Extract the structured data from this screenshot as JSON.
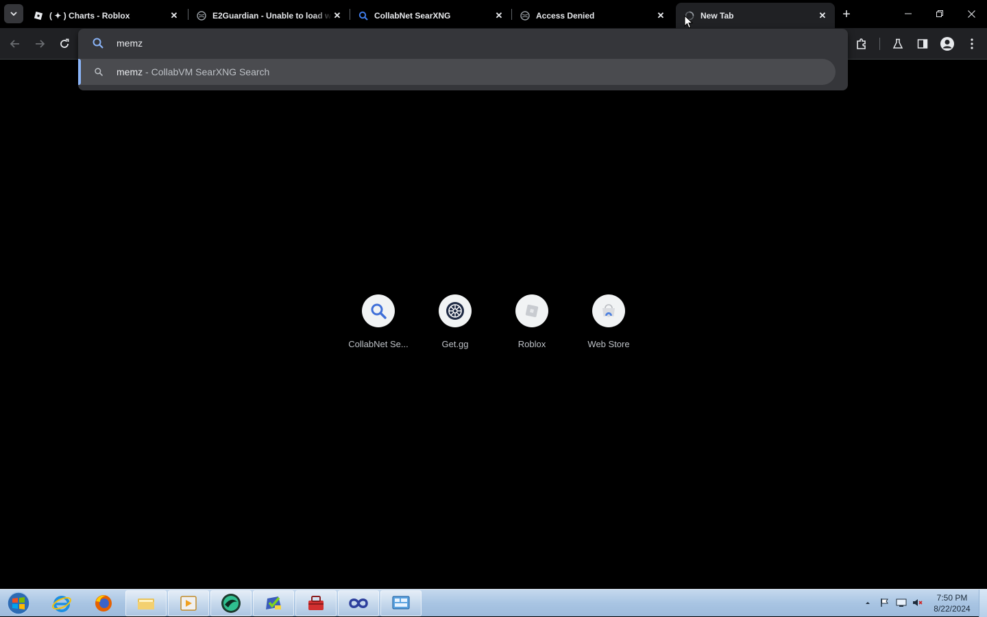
{
  "browser": {
    "tabs": [
      {
        "title": "( ✦ ) Charts - Roblox",
        "icon": "roblox-icon",
        "active": false
      },
      {
        "title": "E2Guardian - Unable to load w",
        "icon": "globe-icon",
        "active": false
      },
      {
        "title": "CollabNet SearXNG",
        "icon": "search-icon",
        "active": false
      },
      {
        "title": "Access Denied",
        "icon": "globe-icon",
        "active": false
      },
      {
        "title": "New Tab",
        "icon": "loading-icon",
        "active": true
      }
    ],
    "close_glyph": "✕",
    "new_tab_glyph": "+",
    "window_controls": {
      "minimize": "—",
      "restore": "❐",
      "close": "✕"
    }
  },
  "omnibox": {
    "value": "memz",
    "suggestion": {
      "query": "memz",
      "separator": " - ",
      "description": "CollabVM SearXNG Search"
    }
  },
  "shortcuts": [
    {
      "label": "CollabNet Se...",
      "icon": "search-icon"
    },
    {
      "label": "Get.gg",
      "icon": "getgg-icon"
    },
    {
      "label": "Roblox",
      "icon": "roblox-icon"
    },
    {
      "label": "Web Store",
      "icon": "webstore-icon"
    }
  ],
  "taskbar": {
    "apps": [
      "internet-explorer-icon",
      "firefox-icon",
      "file-explorer-icon",
      "media-player-icon",
      "browser-icon",
      "checklist-icon",
      "toolbox-icon",
      "infinity-icon",
      "control-panel-icon"
    ],
    "clock_time": "7:50 PM",
    "clock_date": "8/22/2024"
  },
  "colors": {
    "accent": "#8ab4f8",
    "tab_active_bg": "#202124",
    "popup_bg": "#35363a",
    "suggestion_bg": "#4a4b4f",
    "page_bg": "#000000"
  }
}
